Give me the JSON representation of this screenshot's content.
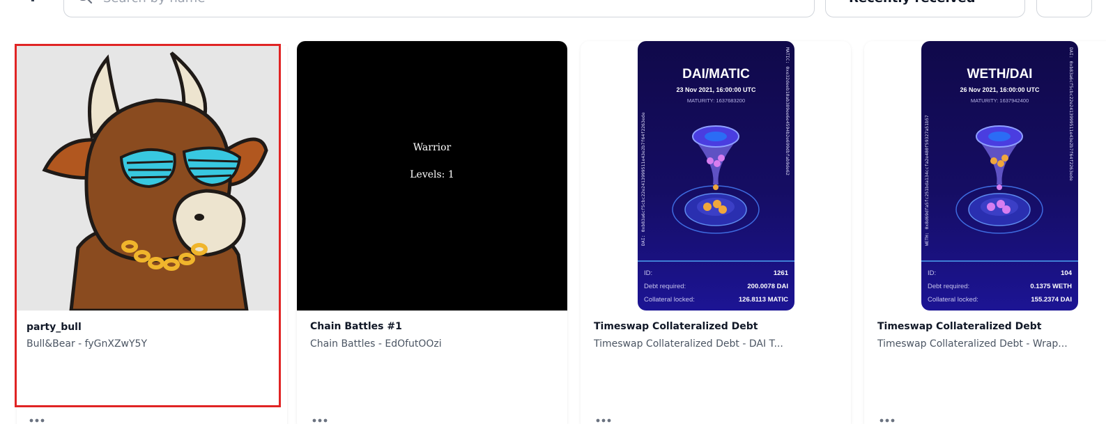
{
  "toolbar": {
    "search_placeholder": "Search by name",
    "sort_value": "Recently received"
  },
  "cards": [
    {
      "title": "party_bull",
      "subtitle": "Bull&Bear - fyGnXZwY5Y"
    },
    {
      "title": "Chain Battles #1",
      "subtitle": "Chain Battles - EdOfutOOzi",
      "media_text": {
        "name": "Warrior",
        "levels": "Levels: 1"
      }
    },
    {
      "title": "Timeswap Collateralized Debt",
      "subtitle": "Timeswap Collateralized Debt - DAI T...",
      "media": {
        "pair": "DAI/MATIC",
        "date": "23 Nov 2021, 16:00:00 UTC",
        "maturity": "MATURITY: 1637683200",
        "left_vertical": "DAI: 0xb83a6cf5cbc22e2413999511e43e2b7f64f2263ede",
        "right_vertical": "MATIC: 0xe32deeb10ab389ee6e4594b2e699dbfab9de62",
        "id_label": "ID:",
        "id_value": "1261",
        "debt_label": "Debt required:",
        "debt_value": "200.0078 DAI",
        "collateral_label": "Collateral locked:",
        "collateral_value": "126.8113 MATIC"
      }
    },
    {
      "title": "Timeswap Collateralized Debt",
      "subtitle": "Timeswap Collateralized Debt - Wrap...",
      "media": {
        "pair": "WETH/DAI",
        "date": "26 Nov 2021, 16:00:00 UTC",
        "maturity": "MATURITY: 1637942400",
        "left_vertical": "WETH: 0x8d69dfa5fc251bda134ccfa2e480f59327a51b57",
        "right_vertical": "DAI: 0xb83a6cf5cbc22e2413999511e43e2b7f64f2263ede",
        "id_label": "ID:",
        "id_value": "104",
        "debt_label": "Debt required:",
        "debt_value": "0.1375 WETH",
        "collateral_label": "Collateral locked:",
        "collateral_value": "155.2374 DAI"
      }
    }
  ],
  "colors": {
    "selection_outline": "#e02424",
    "timeswap_bg": "#150d63",
    "bull_background": "#e6e6e6"
  }
}
